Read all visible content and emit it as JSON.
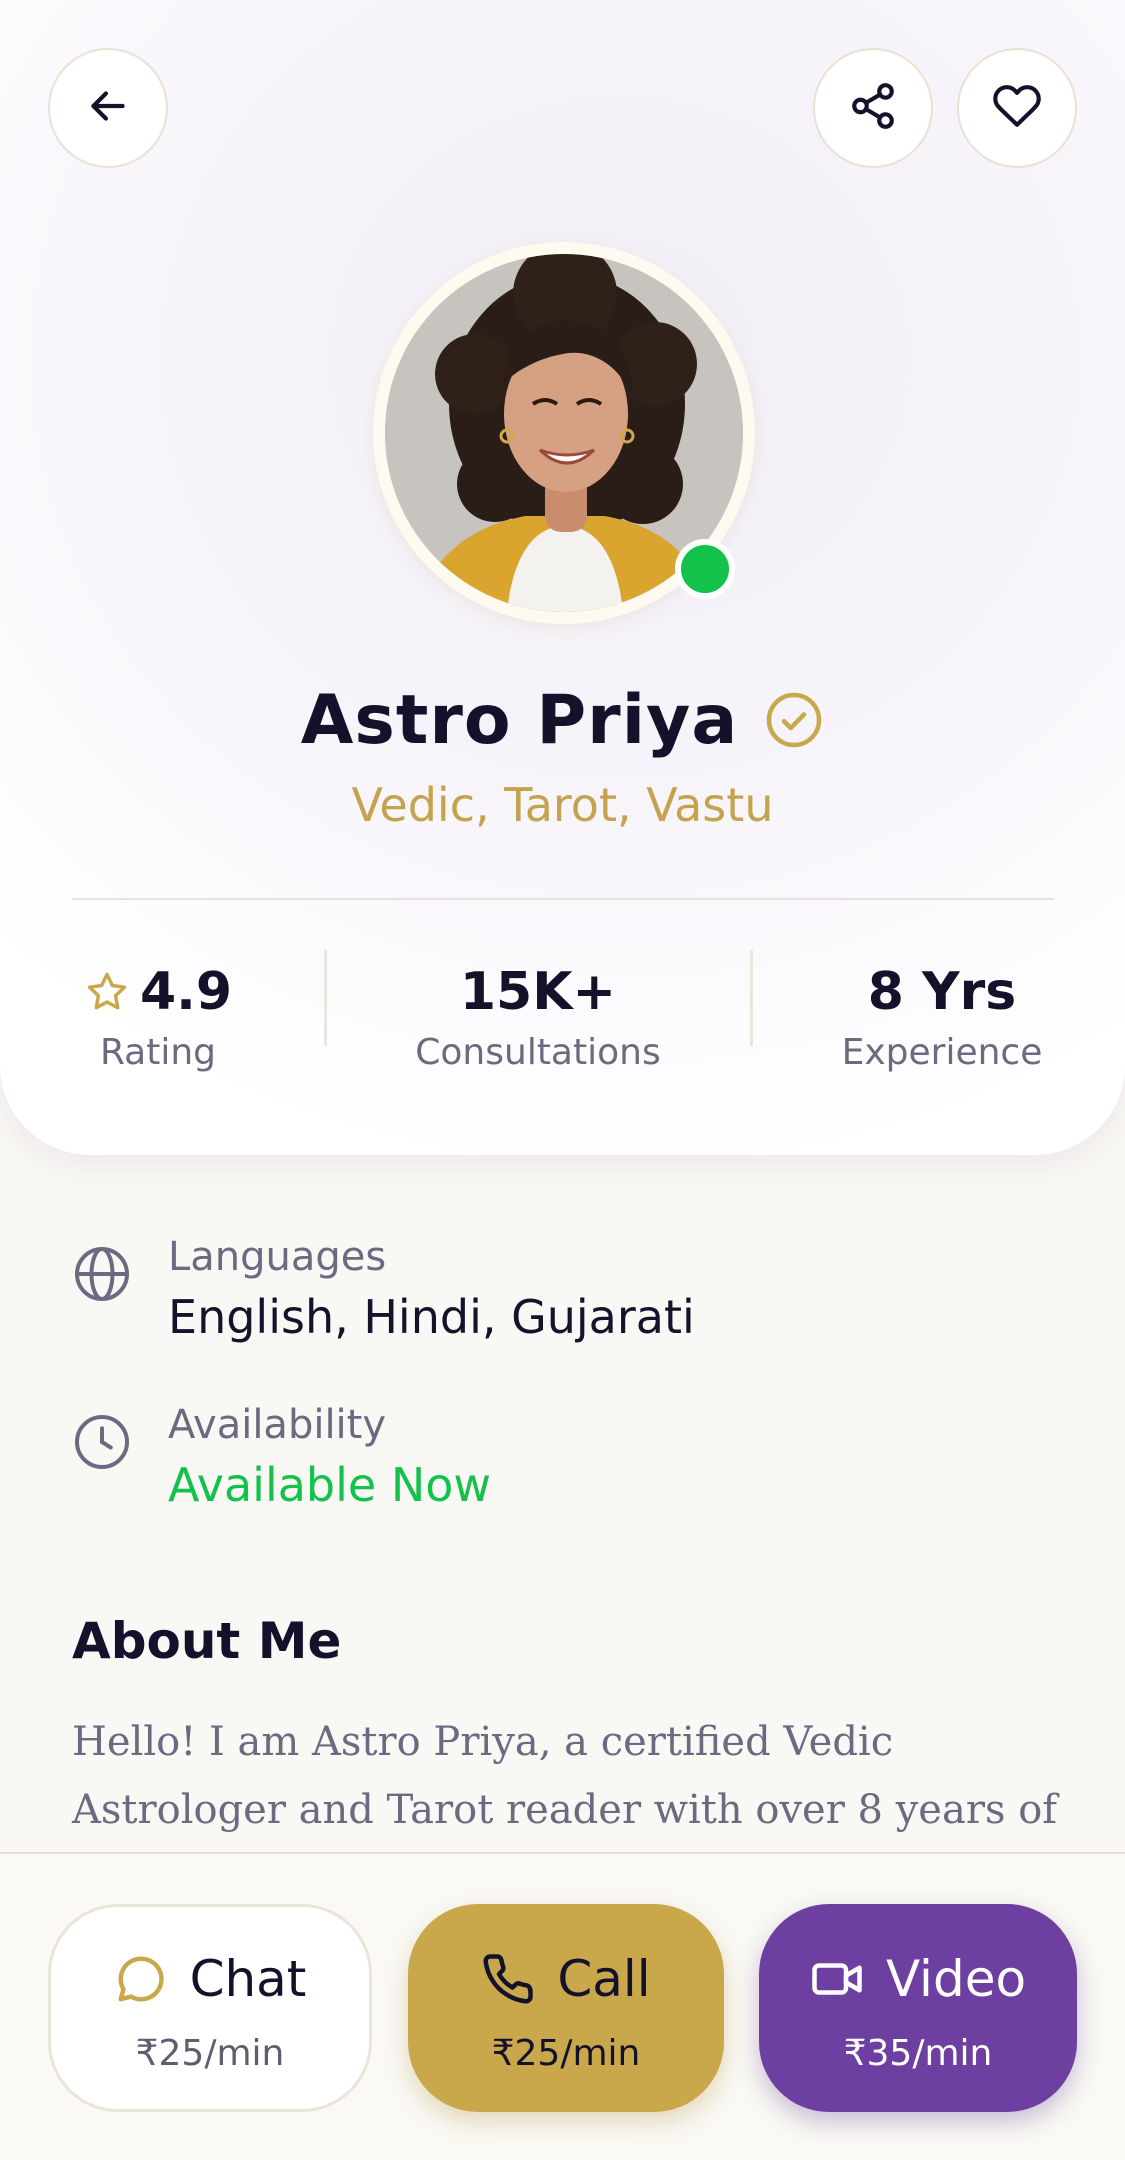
{
  "colors": {
    "accent_gold": "#c9a74b",
    "accent_purple": "#6c3fa0",
    "online_green": "#12c24a",
    "text_dark": "#14112a",
    "text_muted": "#6b6a80",
    "speciality_gold": "#c4a24e"
  },
  "header": {
    "back_icon": "arrow-left-icon",
    "share_icon": "share-icon",
    "favorite_icon": "heart-icon"
  },
  "profile": {
    "name": "Astro Priya",
    "verified_icon": "check-circle-icon",
    "specialities": "Vedic, Tarot, Vastu",
    "online_status_icon": "online-dot"
  },
  "stats": [
    {
      "value": "4.9",
      "label": "Rating",
      "icon": "star-icon"
    },
    {
      "value": "15K+",
      "label": "Consultations"
    },
    {
      "value": "8 Yrs",
      "label": "Experience"
    }
  ],
  "info": {
    "languages": {
      "icon": "globe-icon",
      "label": "Languages",
      "value": "English, Hindi, Gujarati"
    },
    "availability": {
      "icon": "clock-icon",
      "label": "Availability",
      "value": "Available Now"
    }
  },
  "about": {
    "title": "About Me",
    "text": "Hello! I am Astro Priya, a certified Vedic Astrologer and Tarot reader with over 8 years of"
  },
  "actions": [
    {
      "label": "Chat",
      "price": "₹25/min",
      "icon": "chat-bubble-icon"
    },
    {
      "label": "Call",
      "price": "₹25/min",
      "icon": "phone-icon"
    },
    {
      "label": "Video",
      "price": "₹35/min",
      "icon": "video-camera-icon"
    }
  ]
}
